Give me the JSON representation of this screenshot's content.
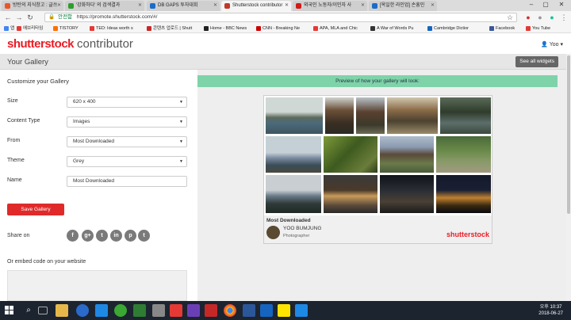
{
  "browser": {
    "tabs": [
      {
        "label": "방탄의 지식창고 : 글쓰",
        "color": "#e8562a"
      },
      {
        "label": "'강화하다' 의 검색결과",
        "color": "#2e9d2e"
      },
      {
        "label": "DB GAPS 투자대회",
        "color": "#1a6cc9"
      },
      {
        "label": "Shutterstock contributor",
        "color": "#c0392b"
      },
      {
        "label": "외국인 노동자/이민자 사",
        "color": "#d11a1a"
      },
      {
        "label": "[옥일한 라인업] 손흥민",
        "color": "#1a6cc9"
      }
    ],
    "url": "https://promote.shutterstock.com/#/",
    "secure_label": "안전함",
    "bookmarks": [
      {
        "label": "앱",
        "color": "#4285f4"
      },
      {
        "label": "에브리타임",
        "color": "#e53935"
      },
      {
        "label": "TISTORY",
        "color": "#ff6f00"
      },
      {
        "label": "TED: Ideas worth s",
        "color": "#e53935"
      },
      {
        "label": "콘텐츠 업로드 | Shutt",
        "color": "#c62828"
      },
      {
        "label": "Home - BBC News",
        "color": "#222222"
      },
      {
        "label": "CNN - Breaking Ne",
        "color": "#cc0000"
      },
      {
        "label": "APA, MLA and Chic",
        "color": "#e53935"
      },
      {
        "label": "A War of Words Pu",
        "color": "#333333"
      },
      {
        "label": "Cambridge Dictior",
        "color": "#1565c0"
      },
      {
        "label": "Facebook",
        "color": "#3b5998"
      },
      {
        "label": "You Tube",
        "color": "#e53935"
      }
    ]
  },
  "site": {
    "logo_text": "shutterstock",
    "logo_sub": "contributor",
    "user": "Yoo",
    "page_title": "Your Gallery",
    "see_widgets": "See all widgets"
  },
  "form": {
    "heading": "Customize your Gallery",
    "fields": [
      {
        "label": "Size",
        "value": "620 x 400",
        "type": "select"
      },
      {
        "label": "Content Type",
        "value": "Images",
        "type": "select"
      },
      {
        "label": "From",
        "value": "Most Downloaded",
        "type": "select"
      },
      {
        "label": "Theme",
        "value": "Grey",
        "type": "select"
      },
      {
        "label": "Name",
        "value": "Most Downloaded",
        "type": "text"
      }
    ],
    "save_label": "Save Gallery",
    "share_label": "Share on",
    "share_icons": [
      "f",
      "g+",
      "t",
      "in",
      "p",
      "t"
    ],
    "embed_label": "Or embed code on your website"
  },
  "preview": {
    "banner": "Preview of how your gallery will look:",
    "gallery_title": "Most Downloaded",
    "author": "YOO BUMJUNG",
    "role": "Photographer",
    "brand": "shutterstock"
  },
  "taskbar": {
    "time": "오후 10:37",
    "date": "2018-06-27"
  }
}
